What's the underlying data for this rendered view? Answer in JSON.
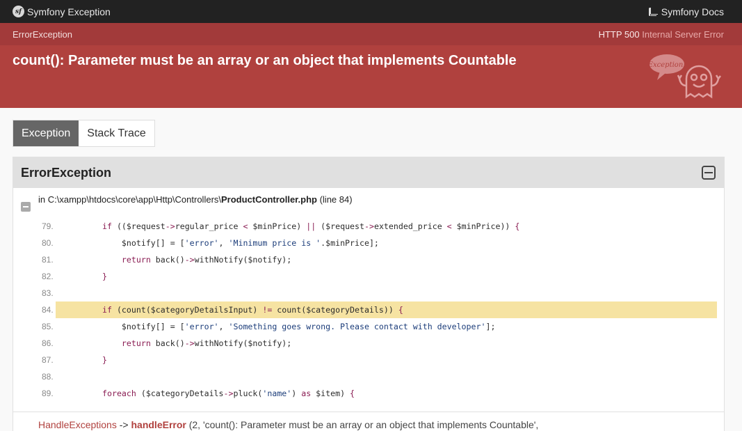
{
  "topbar": {
    "brand": "Symfony Exception",
    "brand_icon": "symfony-logo-icon",
    "docs_label": "Symfony Docs",
    "docs_icon": "book-icon"
  },
  "status": {
    "exception_class": "ErrorException",
    "http_code": "HTTP 500",
    "http_text": "Internal Server Error"
  },
  "header": {
    "message": "count(): Parameter must be an array or an object that implements Countable",
    "illustration_text": "Exception!"
  },
  "tabs": [
    {
      "label": "Exception",
      "active": true
    },
    {
      "label": "Stack Trace",
      "active": false
    }
  ],
  "panel": {
    "title": "ErrorException",
    "file_prefix": "in C:\\xampp\\htdocs\\core\\app\\Http\\Controllers\\",
    "file_name": "ProductController.php",
    "file_line": "(line 84)",
    "highlight_line": "84.",
    "code": [
      {
        "num": "79.",
        "tokens": [
          [
            "kw",
            "if"
          ],
          [
            "var",
            " (("
          ],
          [
            "var",
            "$request"
          ],
          [
            "op",
            "->"
          ],
          [
            "var",
            "regular_price "
          ],
          [
            "op",
            "<"
          ],
          [
            "var",
            " $minPrice) "
          ],
          [
            "op",
            "||"
          ],
          [
            "var",
            " ("
          ],
          [
            "var",
            "$request"
          ],
          [
            "op",
            "->"
          ],
          [
            "var",
            "extended_price "
          ],
          [
            "op",
            "<"
          ],
          [
            "var",
            " $minPrice)) "
          ],
          [
            "op",
            "{"
          ]
        ]
      },
      {
        "num": "80.",
        "tokens": [
          [
            "var",
            "    $notify[] = ["
          ],
          [
            "str",
            "'error'"
          ],
          [
            "var",
            ", "
          ],
          [
            "str",
            "'Minimum price is '"
          ],
          [
            "var",
            "."
          ],
          [
            "var",
            "$minPrice];"
          ]
        ]
      },
      {
        "num": "81.",
        "tokens": [
          [
            "kw",
            "    return"
          ],
          [
            "var",
            " back()"
          ],
          [
            "op",
            "->"
          ],
          [
            "var",
            "withNotify($notify);"
          ]
        ]
      },
      {
        "num": "82.",
        "tokens": [
          [
            "op",
            "}"
          ]
        ]
      },
      {
        "num": "83.",
        "tokens": []
      },
      {
        "num": "84.",
        "tokens": [
          [
            "kw",
            "if"
          ],
          [
            "var",
            " (count($categoryDetailsInput) "
          ],
          [
            "op",
            "!="
          ],
          [
            "var",
            " count($categoryDetails)) "
          ],
          [
            "op",
            "{"
          ]
        ]
      },
      {
        "num": "85.",
        "tokens": [
          [
            "var",
            "    $notify[] = ["
          ],
          [
            "str",
            "'error'"
          ],
          [
            "var",
            ", "
          ],
          [
            "str",
            "'Something goes wrong. Please contact with developer'"
          ],
          [
            "var",
            "];"
          ]
        ]
      },
      {
        "num": "86.",
        "tokens": [
          [
            "kw",
            "    return"
          ],
          [
            "var",
            " back()"
          ],
          [
            "op",
            "->"
          ],
          [
            "var",
            "withNotify($notify);"
          ]
        ]
      },
      {
        "num": "87.",
        "tokens": [
          [
            "op",
            "}"
          ]
        ]
      },
      {
        "num": "88.",
        "tokens": []
      },
      {
        "num": "89.",
        "tokens": [
          [
            "kw",
            "foreach"
          ],
          [
            "var",
            " ($categoryDetails"
          ],
          [
            "op",
            "->"
          ],
          [
            "var",
            "pluck("
          ],
          [
            "str",
            "'name'"
          ],
          [
            "var",
            ") "
          ],
          [
            "kw",
            "as"
          ],
          [
            "var",
            " $item) "
          ],
          [
            "op",
            "{"
          ]
        ]
      }
    ],
    "trace": {
      "class": "HandleExceptions",
      "arrow": "->",
      "function": "handleError",
      "args": "(2, 'count(): Parameter must be an array or an object that implements Countable',"
    }
  }
}
